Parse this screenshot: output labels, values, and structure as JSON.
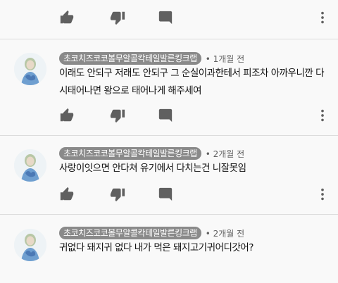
{
  "top_actions": {
    "like_icon": "thumbs-up-icon",
    "dislike_icon": "thumbs-down-icon",
    "more_icon": "more-vert-icon"
  },
  "comments": [
    {
      "author": "초코치즈코코볼무알콜칵테일발른킹크랩",
      "time": "• 1개월 전",
      "text": "이래도 안되구 저래도 안되구 그 순실이과한테서 피조차 아까우니깐 다시태어나면 왕으로 태어나게 해주세여"
    },
    {
      "author": "초코치즈코코볼무알콜칵테일발른킹크랩",
      "time": "• 2개월 전",
      "text": "사랑이잇으면 안다쳐 유기에서 다치는건 니잘못임"
    },
    {
      "author": "초코치즈코코볼무알콜칵테일발른킹크랩",
      "time": "• 2개월 전",
      "text": "귀없다 돼지귀 없다 내가 먹은 돼지고기귀어디갓어?"
    }
  ],
  "colors": {
    "background": "#f9f9f9",
    "chip": "#8a8a8a",
    "icon": "#606060",
    "divider": "#dcdcdc"
  }
}
